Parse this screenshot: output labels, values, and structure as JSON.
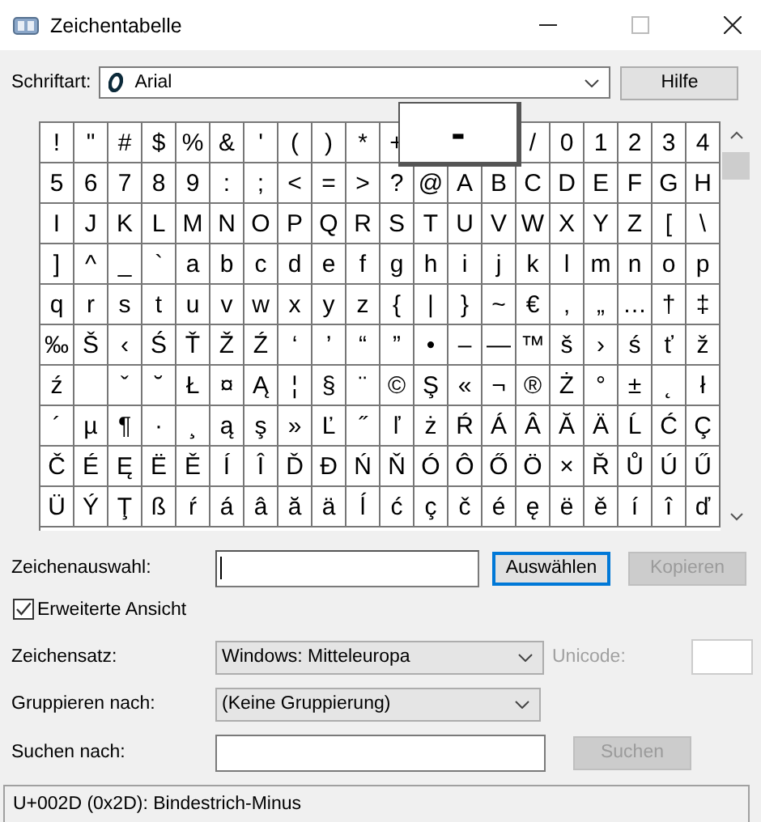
{
  "window": {
    "title": "Zeichentabelle"
  },
  "font": {
    "label": "Schriftart:",
    "value": "Arial",
    "help_button": "Hilfe"
  },
  "grid": {
    "rows": [
      [
        "!",
        "\"",
        "#",
        "$",
        "%",
        "&",
        "'",
        "(",
        ")",
        "*",
        "+",
        "",
        "",
        "",
        "/",
        "0",
        "1",
        "2",
        "3",
        "4"
      ],
      [
        "5",
        "6",
        "7",
        "8",
        "9",
        ":",
        ";",
        "<",
        "=",
        ">",
        "?",
        "@",
        "A",
        "B",
        "C",
        "D",
        "E",
        "F",
        "G",
        "H"
      ],
      [
        "I",
        "J",
        "K",
        "L",
        "M",
        "N",
        "O",
        "P",
        "Q",
        "R",
        "S",
        "T",
        "U",
        "V",
        "W",
        "X",
        "Y",
        "Z",
        "[",
        "\\"
      ],
      [
        "]",
        "^",
        "_",
        "`",
        "a",
        "b",
        "c",
        "d",
        "e",
        "f",
        "g",
        "h",
        "i",
        "j",
        "k",
        "l",
        "m",
        "n",
        "o",
        "p"
      ],
      [
        "q",
        "r",
        "s",
        "t",
        "u",
        "v",
        "w",
        "x",
        "y",
        "z",
        "{",
        "|",
        "}",
        "~",
        "€",
        "‚",
        "„",
        "…",
        "†",
        "‡"
      ],
      [
        "‰",
        "Š",
        "‹",
        "Ś",
        "Ť",
        "Ž",
        "Ź",
        "‘",
        "’",
        "“",
        "”",
        "•",
        "–",
        "—",
        "™",
        "š",
        "›",
        "ś",
        "ť",
        "ž"
      ],
      [
        "ź",
        null,
        "ˇ",
        "˘",
        "Ł",
        "¤",
        "Ą",
        "¦",
        "§",
        "¨",
        "©",
        "Ş",
        "«",
        "¬",
        "®",
        "Ż",
        "°",
        "±",
        "˛",
        "ł"
      ],
      [
        "´",
        "µ",
        "¶",
        "·",
        "¸",
        "ą",
        "ş",
        "»",
        "Ľ",
        "˝",
        "ľ",
        "ż",
        "Ŕ",
        "Á",
        "Â",
        "Ă",
        "Ä",
        "Ĺ",
        "Ć",
        "Ç"
      ],
      [
        "Č",
        "É",
        "Ę",
        "Ë",
        "Ě",
        "Í",
        "Î",
        "Ď",
        "Đ",
        "Ń",
        "Ň",
        "Ó",
        "Ô",
        "Ő",
        "Ö",
        "×",
        "Ř",
        "Ů",
        "Ú",
        "Ű"
      ],
      [
        "Ü",
        "Ý",
        "Ţ",
        "ß",
        "ŕ",
        "á",
        "â",
        "ă",
        "ä",
        "ĺ",
        "ć",
        "ç",
        "č",
        "é",
        "ę",
        "ë",
        "ě",
        "í",
        "î",
        "ď"
      ]
    ],
    "magnified": "-"
  },
  "selection": {
    "label": "Zeichenauswahl:",
    "select_button": "Auswählen",
    "copy_button": "Kopieren",
    "copy_disabled": true
  },
  "advanced_view": {
    "label": "Erweiterte Ansicht",
    "checked": true
  },
  "charset": {
    "label": "Zeichensatz:",
    "value": "Windows: Mitteleuropa",
    "unicode_label": "Unicode:",
    "unicode_disabled": true
  },
  "group_by": {
    "label": "Gruppieren nach:",
    "value": "(Keine Gruppierung)"
  },
  "search": {
    "label": "Suchen nach:",
    "button": "Suchen",
    "button_disabled": true
  },
  "status_bar": "U+002D (0x2D): Bindestrich-Minus"
}
